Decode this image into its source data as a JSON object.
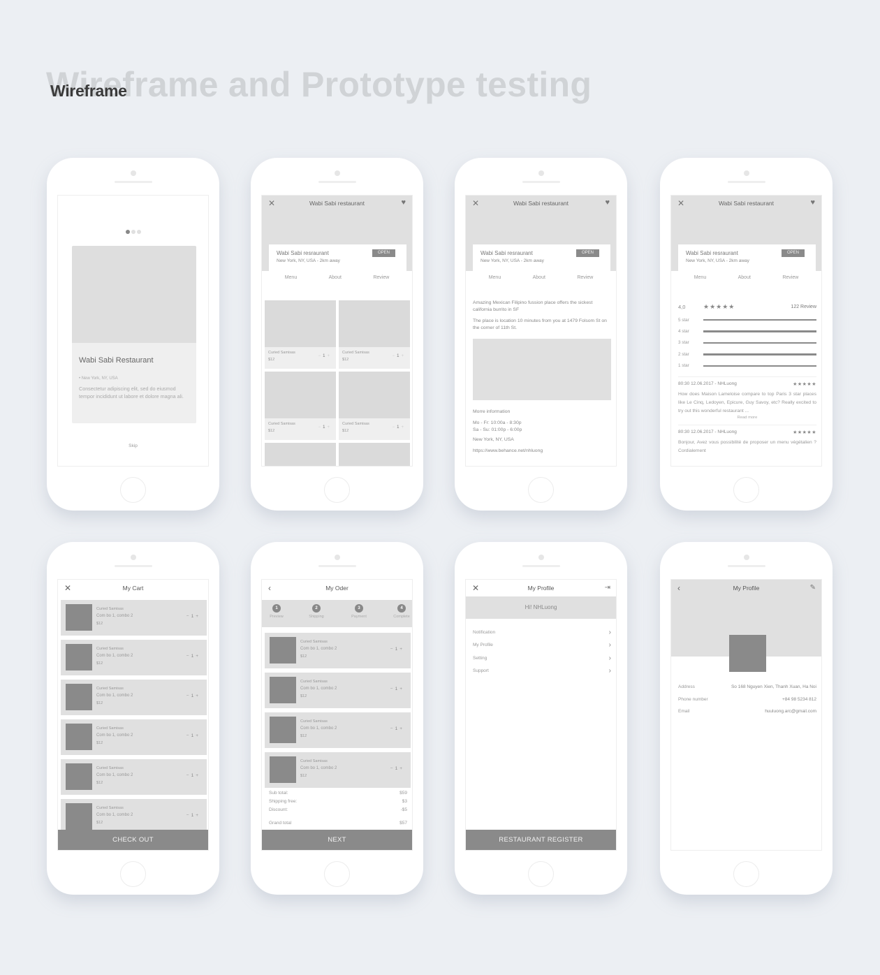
{
  "page": {
    "background_title": "Wireframe and Prototype testing",
    "title": "Wireframe"
  },
  "colors": {
    "background": "#eceff3",
    "placeholder_light": "#e0e0e0",
    "placeholder_dark": "#8a8a8a",
    "text": "#777777"
  },
  "onboarding": {
    "pager_active_index": 0,
    "pager_count": 3,
    "card_title": "Wabi Sabi Restaurant",
    "location": "• New York, NY, USA",
    "description": "Consectetur  adipiscing elit, sed do eiusmod tempor incididunt ut labore et dolore magna ali.",
    "skip_label": "Skip"
  },
  "restaurant": {
    "title": "Wabi Sabi restaurant",
    "close_icon": "close-icon",
    "heart_icon": "heart-icon",
    "card_name": "Wabi Sabi resraurant",
    "card_address": "New York, NY, USA - 2km away",
    "status_badge": "OPEN",
    "tabs": [
      "Menu",
      "About",
      "Review"
    ]
  },
  "menu_screen": {
    "items": [
      {
        "name": "Curied Samisas",
        "price": "$12",
        "qty": "1"
      },
      {
        "name": "Curied Samisas",
        "price": "$12",
        "qty": "1"
      },
      {
        "name": "Curied Samisas",
        "price": "$12",
        "qty": "1"
      },
      {
        "name": "Curied Samisas",
        "price": "$12",
        "qty": "1"
      }
    ],
    "minus": "−",
    "plus": "+"
  },
  "about_screen": {
    "para1": "Amazing Mexican Filipino fussion place offers the sickest california burrito in SF",
    "para2": "The place is location 10 minutes from you at 1479 Folsom St on the corner of 11th St.",
    "more_info_label": "Morre information",
    "hours_weekday": "Mo - Fr: 10:00a - 8:30p",
    "hours_weekend": "Sa - Su: 01:00p - 6:00p",
    "city": "New York, NY, USA",
    "link": "https://www.behance.net/nhluong"
  },
  "review_screen": {
    "score": "4,0",
    "stars": "★★★★★",
    "review_count": "122 Review",
    "breakdown": [
      {
        "label": "5 star",
        "fraction": 1.0
      },
      {
        "label": "4 star",
        "fraction": 1.0
      },
      {
        "label": "3 star",
        "fraction": 1.0
      },
      {
        "label": "2 star",
        "fraction": 1.0
      },
      {
        "label": "1 star",
        "fraction": 1.0
      }
    ],
    "reviews": [
      {
        "meta": "80:30 12.06.2017 - NHLuong",
        "stars": "★★★★★",
        "text": "How does Maison Lameloise compare to top Paris 3 star places like Le Cinq, Ledoyen, Epicure, Guy Savoy, etc? Really excited to try out this wonderful restaurant ...",
        "read_more": "Read more"
      },
      {
        "meta": "80:30 12.06.2017 - NHLuong",
        "stars": "★★★★★",
        "text": "Bonjour, Avez vous possibilité de proposer un menu végétalien ? Cordialement"
      }
    ]
  },
  "cart_screen": {
    "title": "My Cart",
    "items": [
      {
        "name": "Curied Samisas",
        "option": "Com bo 1, combo 2",
        "price": "$12",
        "qty": "1"
      },
      {
        "name": "Curied Samisas",
        "option": "Com bo 1, combo 2",
        "price": "$12",
        "qty": "1"
      },
      {
        "name": "Curied Samisas",
        "option": "Com bo 1, combo 2",
        "price": "$12",
        "qty": "1"
      },
      {
        "name": "Curied Samisas",
        "option": "Com bo 1, combo 2",
        "price": "$12",
        "qty": "1"
      },
      {
        "name": "Curied Samisas",
        "option": "Com bo 1, combo 2",
        "price": "$12",
        "qty": "1"
      },
      {
        "name": "Curied Samisas",
        "option": "Com bo 1, combo 2",
        "price": "$12",
        "qty": "1"
      }
    ],
    "checkout_label": "CHECK OUT"
  },
  "order_screen": {
    "title": "My Oder",
    "steps": [
      {
        "num": "1",
        "label": "Preview"
      },
      {
        "num": "2",
        "label": "Shipping"
      },
      {
        "num": "3",
        "label": "Payment"
      },
      {
        "num": "4",
        "label": "Complete"
      }
    ],
    "items": [
      {
        "name": "Curied Samisas",
        "option": "Com bo 1, combo 2",
        "price": "$12",
        "qty": "1"
      },
      {
        "name": "Curied Samisas",
        "option": "Com bo 1, combo 2",
        "price": "$12",
        "qty": "1"
      },
      {
        "name": "Curied Samisas",
        "option": "Com bo 1, combo 2",
        "price": "$12",
        "qty": "1"
      },
      {
        "name": "Curied Samisas",
        "option": "Com bo 1, combo 2",
        "price": "$12",
        "qty": "1"
      }
    ],
    "totals": [
      {
        "label": "Sub total:",
        "value": "$59"
      },
      {
        "label": "Shipping free:",
        "value": "$3"
      },
      {
        "label": "Discount:",
        "value": "-$5"
      }
    ],
    "grand_total_label": "Grand total",
    "grand_total_value": "$57",
    "next_label": "NEXT"
  },
  "profile_menu_screen": {
    "title": "My Profile",
    "greeting": "Hi! NHLuong",
    "items": [
      "Notification",
      "My Profile",
      "Setting",
      "Support"
    ],
    "register_label": "RESTAURANT REGISTER"
  },
  "profile_detail_screen": {
    "title": "My Profile",
    "fields": [
      {
        "label": "Address",
        "value": "So 168 Nguyen Xien, Thanh Xuan, Ha Noi"
      },
      {
        "label": "Phone number",
        "value": "+84 98 5234 812"
      },
      {
        "label": "Email",
        "value": "huuluong.arc@gmail.com"
      }
    ]
  }
}
